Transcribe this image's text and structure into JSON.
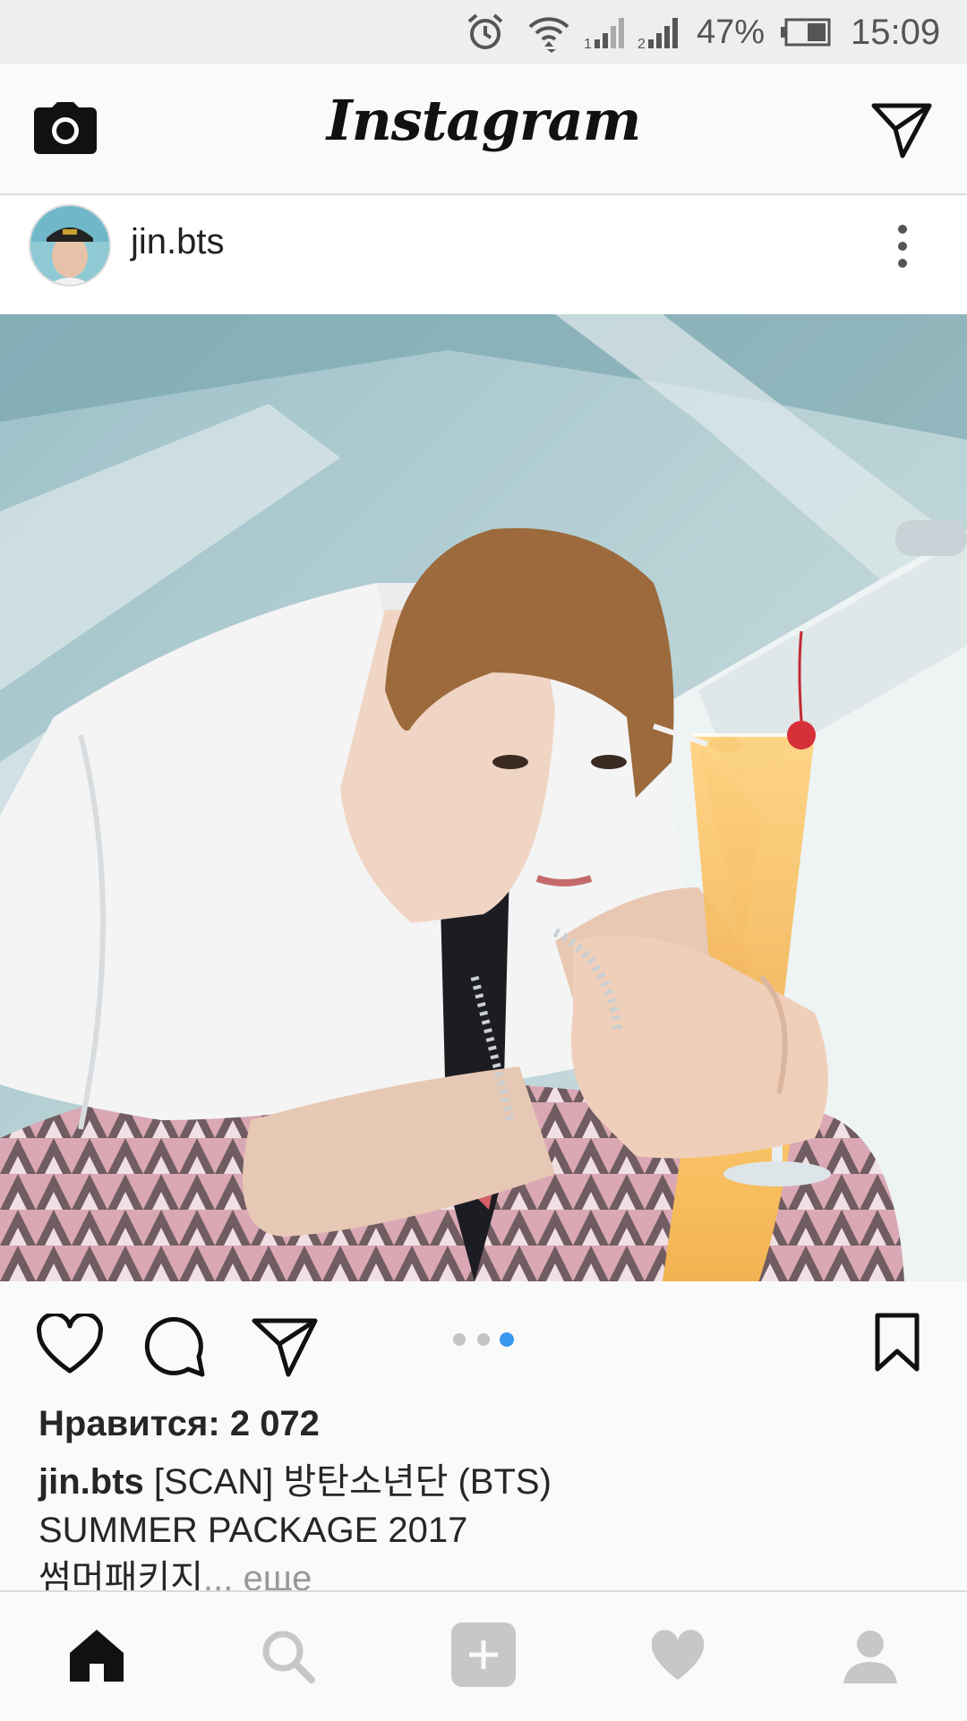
{
  "status_bar": {
    "battery": "47%",
    "time": "15:09"
  },
  "app": {
    "title": "Instagram"
  },
  "post": {
    "username": "jin.bts",
    "likes": "Нравится: 2 072",
    "caption_user": "jin.bts",
    "caption_line1": " [SCAN] 방탄소년단 (BTS)",
    "caption_line2": " SUMMER PACKAGE 2017",
    "caption_line3": "썸머패키지",
    "caption_ellipsis": "...",
    "caption_more": " еще",
    "carousel": {
      "count": 3,
      "active": 3
    }
  },
  "colors": {
    "accent": "#3897f0",
    "dot_inactive": "#c4c4c4",
    "icon_inactive": "#c7c7c7"
  },
  "icons": [
    "camera-icon",
    "direct-message-icon",
    "more-options-icon",
    "heart-icon",
    "comment-icon",
    "share-icon",
    "bookmark-icon",
    "home-icon",
    "search-icon",
    "add-post-icon",
    "activity-heart-icon",
    "profile-icon",
    "alarm-icon",
    "wifi-icon",
    "signal-icon",
    "battery-icon"
  ]
}
